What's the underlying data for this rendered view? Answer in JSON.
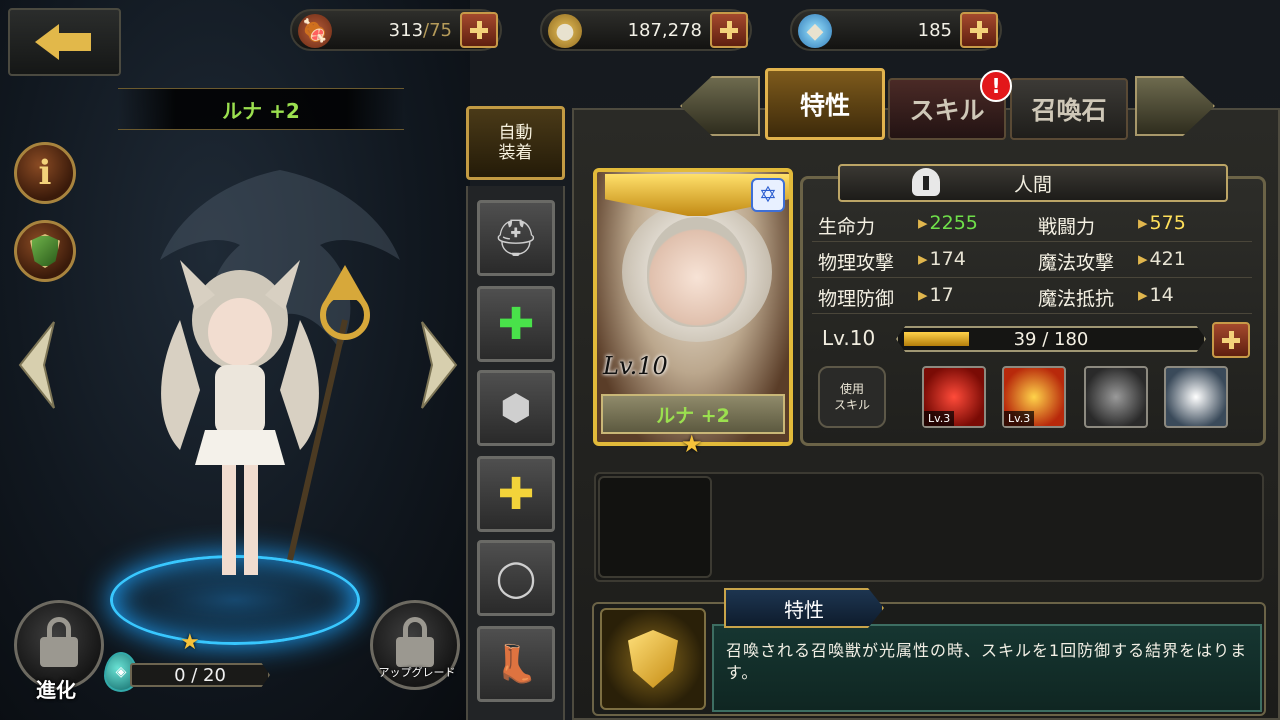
{
  "resources": {
    "stamina": {
      "value": "313",
      "cap": "/75",
      "icon": "meat-icon"
    },
    "gold": {
      "value": "187,278",
      "icon": "coin-icon"
    },
    "gems": {
      "value": "185",
      "icon": "diamond-icon"
    }
  },
  "hero": {
    "name": "ルナ +2",
    "evolve_label": "進化",
    "upgrade_label": "アップグレード",
    "evolve_progress": "0 / 20"
  },
  "equipment": {
    "auto_equip_label": "自動\n装着",
    "slots": [
      "helmet",
      "ring-add",
      "armor",
      "amulet-add",
      "ring",
      "boots"
    ]
  },
  "tabs": [
    {
      "label": "特性",
      "active": true
    },
    {
      "label": "スキル",
      "active": false,
      "alert": "!"
    },
    {
      "label": "召喚石",
      "active": false
    }
  ],
  "card": {
    "level": "Lv.10",
    "name": "ルナ +2",
    "stars": 1
  },
  "stats": {
    "race": "人間",
    "rows": [
      {
        "l1": "生命力",
        "v1": "2255",
        "l2": "戦闘力",
        "v2": "575"
      },
      {
        "l1": "物理攻撃",
        "v1": "174",
        "l2": "魔法攻撃",
        "v2": "421"
      },
      {
        "l1": "物理防御",
        "v1": "17",
        "l2": "魔法抵抗",
        "v2": "14"
      }
    ],
    "level_label": "Lv.10",
    "xp_text": "39 / 180",
    "xp_fraction": 0.2167
  },
  "skills": {
    "use_label": "使用\nスキル",
    "slots": [
      {
        "level": "Lv.3",
        "colors": [
          "#ff4b3a",
          "#7a0b05"
        ]
      },
      {
        "level": "Lv.3",
        "colors": [
          "#ffd34a",
          "#b8290b"
        ]
      },
      {
        "level": "",
        "colors": [
          "#9a9a9a",
          "#2a2a2a"
        ]
      },
      {
        "level": "",
        "colors": [
          "#ffffff",
          "#3a4a5a"
        ]
      }
    ]
  },
  "trait": {
    "title": "特性",
    "description": "召喚される召喚獣が光属性の時、スキルを1回防御する結界をはります。"
  },
  "colors": {
    "accent": "#e1b34d",
    "green": "#6fe04a",
    "yellow": "#ffe05a"
  }
}
